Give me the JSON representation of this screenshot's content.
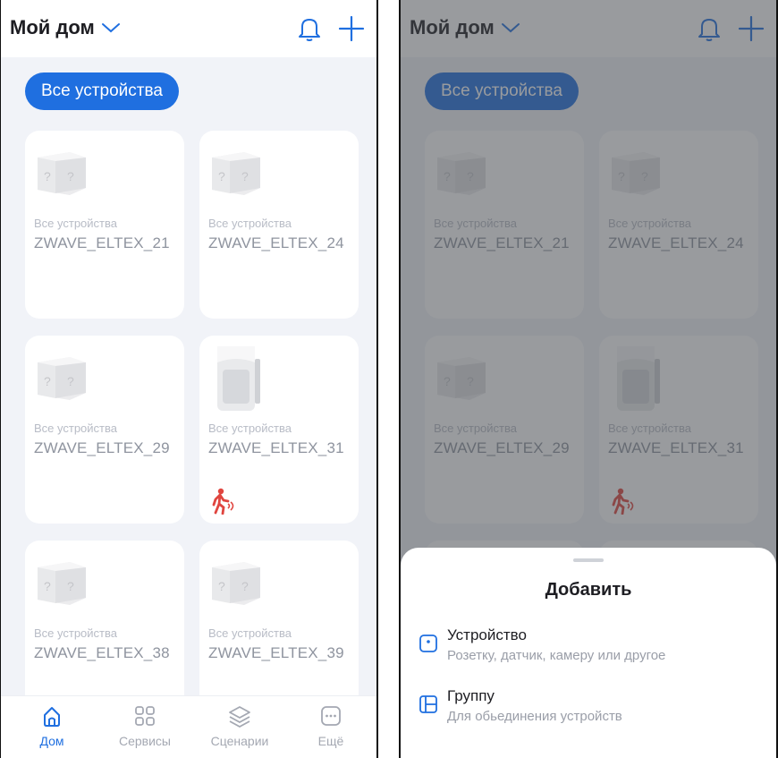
{
  "header": {
    "title": "Мой дом"
  },
  "filter_chip": "Все устройства",
  "cards": [
    {
      "category": "Все устройства",
      "name": "ZWAVE_ELTEX_21",
      "image": "unknown-device-cube",
      "motion": false
    },
    {
      "category": "Все устройства",
      "name": "ZWAVE_ELTEX_24",
      "image": "unknown-device-cube",
      "motion": false
    },
    {
      "category": "Все устройства",
      "name": "ZWAVE_ELTEX_29",
      "image": "unknown-device-cube",
      "motion": false
    },
    {
      "category": "Все устройства",
      "name": "ZWAVE_ELTEX_31",
      "image": "motion-sensor",
      "motion": true
    },
    {
      "category": "Все устройства",
      "name": "ZWAVE_ELTEX_38",
      "image": "unknown-device-cube",
      "motion": false
    },
    {
      "category": "Все устройства",
      "name": "ZWAVE_ELTEX_39",
      "image": "unknown-device-cube",
      "motion": false
    }
  ],
  "tabs": [
    {
      "label": "Дом",
      "icon": "home-icon",
      "active": true
    },
    {
      "label": "Сервисы",
      "icon": "services-grid-icon",
      "active": false
    },
    {
      "label": "Сценарии",
      "icon": "scenarios-layers-icon",
      "active": false
    },
    {
      "label": "Ещё",
      "icon": "more-dots-icon",
      "active": false
    }
  ],
  "sheet": {
    "title": "Добавить",
    "options": [
      {
        "title": "Устройство",
        "subtitle": "Розетку, датчик, камеру или другое",
        "icon": "device-icon"
      },
      {
        "title": "Группу",
        "subtitle": "Для обьединения устройств",
        "icon": "group-icon"
      }
    ]
  },
  "colors": {
    "accent": "#1f6fe0",
    "alert": "#e0453f",
    "background": "#f1f3f8"
  }
}
